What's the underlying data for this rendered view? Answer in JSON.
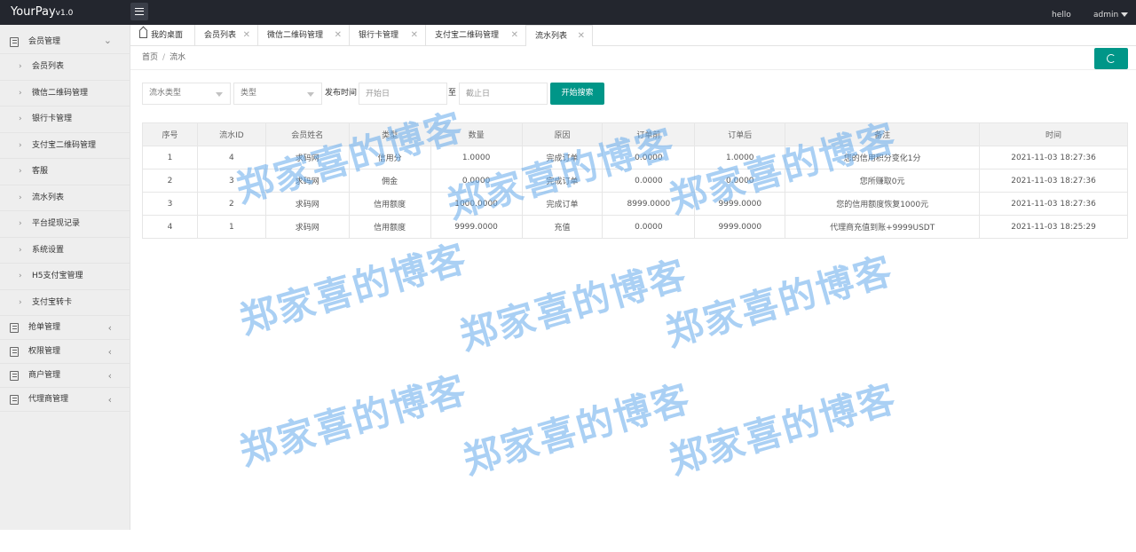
{
  "header": {
    "logo": "YourPay",
    "version": "v1.0",
    "greeting": "hello",
    "user": "admin"
  },
  "sidebar": {
    "groups": [
      {
        "label": "会员管理",
        "expanded": true,
        "items": [
          {
            "label": "会员列表"
          },
          {
            "label": "微信二维码管理"
          },
          {
            "label": "银行卡管理"
          },
          {
            "label": "支付宝二维码管理"
          },
          {
            "label": "客服"
          },
          {
            "label": "流水列表"
          },
          {
            "label": "平台提现记录"
          },
          {
            "label": "系统设置"
          },
          {
            "label": "H5支付宝管理"
          },
          {
            "label": "支付宝转卡"
          }
        ]
      },
      {
        "label": "抢单管理"
      },
      {
        "label": "权限管理"
      },
      {
        "label": "商户管理"
      },
      {
        "label": "代理商管理"
      }
    ]
  },
  "tabs": [
    {
      "label": "我的桌面",
      "closable": false
    },
    {
      "label": "会员列表",
      "closable": true
    },
    {
      "label": "微信二维码管理",
      "closable": true
    },
    {
      "label": "银行卡管理",
      "closable": true
    },
    {
      "label": "支付宝二维码管理",
      "closable": true
    },
    {
      "label": "流水列表",
      "closable": true,
      "active": true
    }
  ],
  "breadcrumb": {
    "home": "首页",
    "current": "流水"
  },
  "filters": {
    "flow_type_placeholder": "流水类型",
    "type_placeholder": "类型",
    "publish_time_label": "发布时间",
    "start_placeholder": "开始日",
    "to_label": "至",
    "end_placeholder": "截止日",
    "search_label": "开始搜索"
  },
  "table": {
    "headers": [
      "序号",
      "流水ID",
      "会员姓名",
      "类型",
      "数量",
      "原因",
      "订单前",
      "订单后",
      "备注",
      "时间"
    ],
    "rows": [
      [
        "1",
        "4",
        "求码网",
        "信用分",
        "1.0000",
        "完成订单",
        "0.0000",
        "1.0000",
        "您的信用积分变化1分",
        "2021-11-03 18:27:36"
      ],
      [
        "2",
        "3",
        "求码网",
        "佣金",
        "0.0000",
        "完成订单",
        "0.0000",
        "0.0000",
        "您所赚取0元",
        "2021-11-03 18:27:36"
      ],
      [
        "3",
        "2",
        "求码网",
        "信用额度",
        "1000.0000",
        "完成订单",
        "8999.0000",
        "9999.0000",
        "您的信用额度恢复1000元",
        "2021-11-03 18:27:36"
      ],
      [
        "4",
        "1",
        "求码网",
        "信用额度",
        "9999.0000",
        "充值",
        "0.0000",
        "9999.0000",
        "代理商充值到账+9999USDT",
        "2021-11-03 18:25:29"
      ]
    ]
  },
  "watermark": "郑家喜的博客",
  "colors": {
    "topbar": "#23262e",
    "accent": "#009688",
    "sidebar": "#eeeeee",
    "watermark": "#64aaeb"
  }
}
